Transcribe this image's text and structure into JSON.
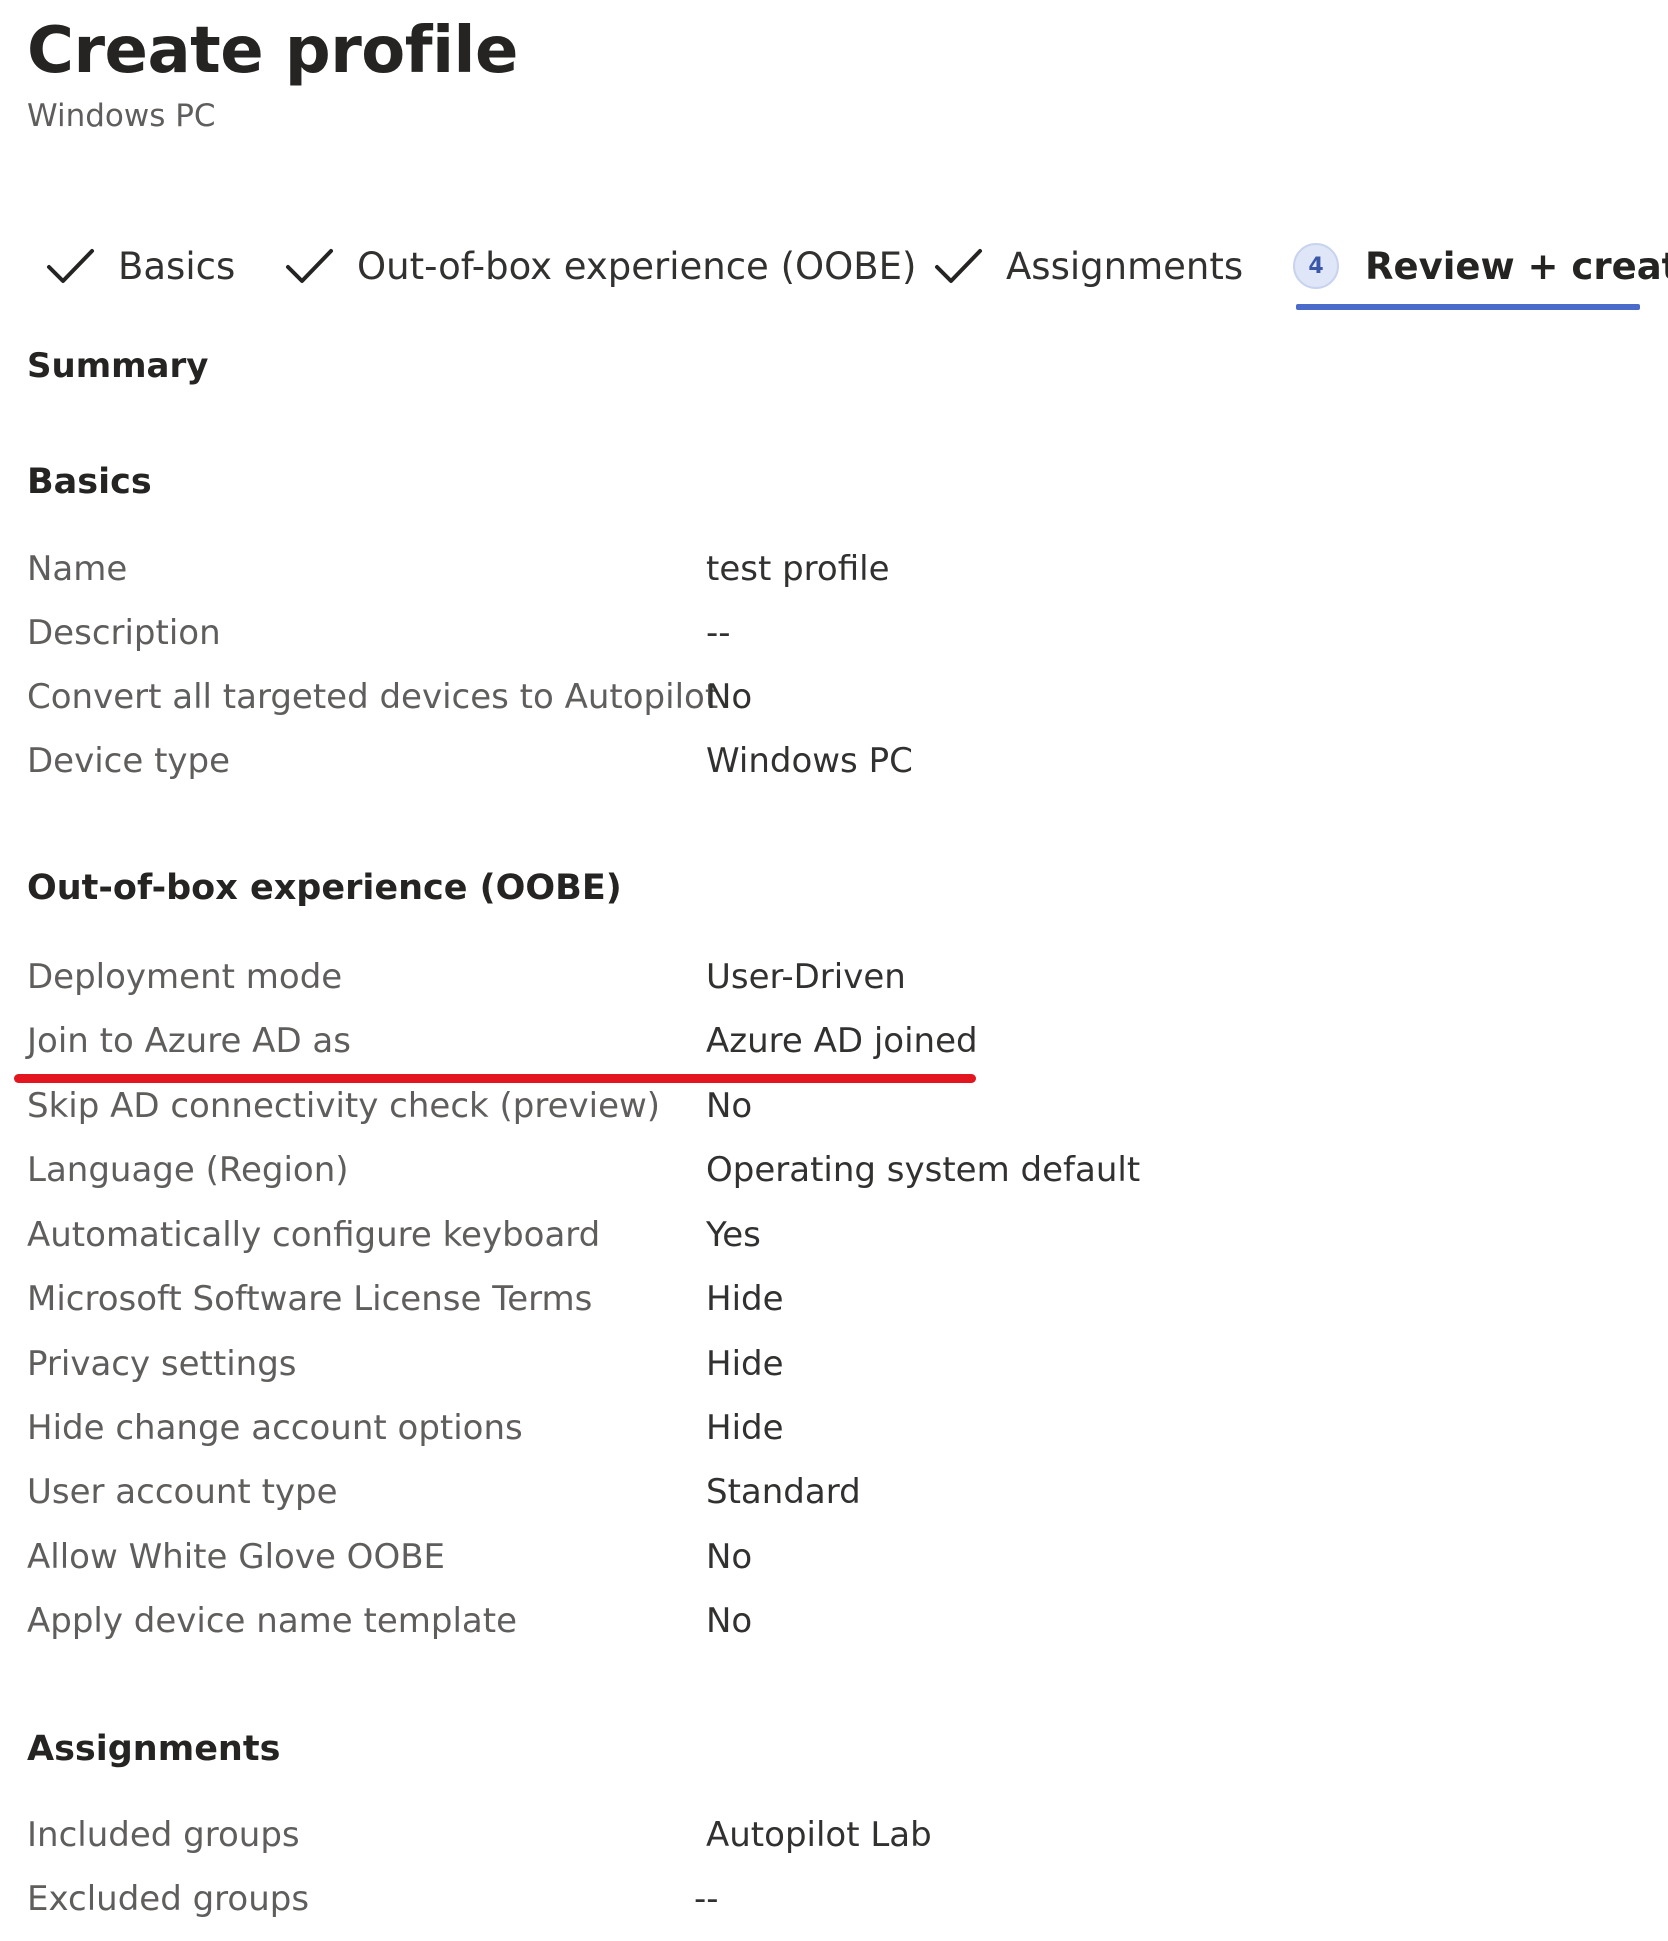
{
  "header": {
    "title": "Create profile",
    "subtitle": "Windows PC"
  },
  "steps": [
    {
      "label": "Basics",
      "state": "completed",
      "icon": "checkmark-icon"
    },
    {
      "label": "Out-of-box experience (OOBE)",
      "state": "completed",
      "icon": "checkmark-icon"
    },
    {
      "label": "Assignments",
      "state": "completed",
      "icon": "checkmark-icon"
    },
    {
      "label": "Review + create",
      "state": "active",
      "number": "4"
    }
  ],
  "summary_heading": "Summary",
  "sections": {
    "basics": {
      "heading": "Basics",
      "rows": [
        {
          "label": "Name",
          "value": "test profile"
        },
        {
          "label": "Description",
          "value": "--"
        },
        {
          "label": "Convert all targeted devices to Autopilot",
          "value": "No"
        },
        {
          "label": "Device type",
          "value": "Windows PC"
        }
      ]
    },
    "oobe": {
      "heading": "Out-of-box experience (OOBE)",
      "rows": [
        {
          "label": "Deployment mode",
          "value": "User-Driven"
        },
        {
          "label": "Join to Azure AD as",
          "value": "Azure AD joined"
        },
        {
          "label": "Skip AD connectivity check (preview)",
          "value": "No"
        },
        {
          "label": "Language (Region)",
          "value": "Operating system default"
        },
        {
          "label": "Automatically configure keyboard",
          "value": "Yes"
        },
        {
          "label": "Microsoft Software License Terms",
          "value": "Hide"
        },
        {
          "label": "Privacy settings",
          "value": "Hide"
        },
        {
          "label": "Hide change account options",
          "value": "Hide"
        },
        {
          "label": "User account type",
          "value": "Standard"
        },
        {
          "label": "Allow White Glove OOBE",
          "value": "No"
        },
        {
          "label": "Apply device name template",
          "value": "No"
        }
      ]
    },
    "assignments": {
      "heading": "Assignments",
      "rows": [
        {
          "label": "Included groups",
          "value": "Autopilot Lab"
        },
        {
          "label": "Excluded groups",
          "value": "--"
        }
      ]
    }
  },
  "colors": {
    "active_tab_underline": "#4a6bc9",
    "annotation_line": "#e3151f",
    "step_badge_bg": "#dfe6f7"
  }
}
